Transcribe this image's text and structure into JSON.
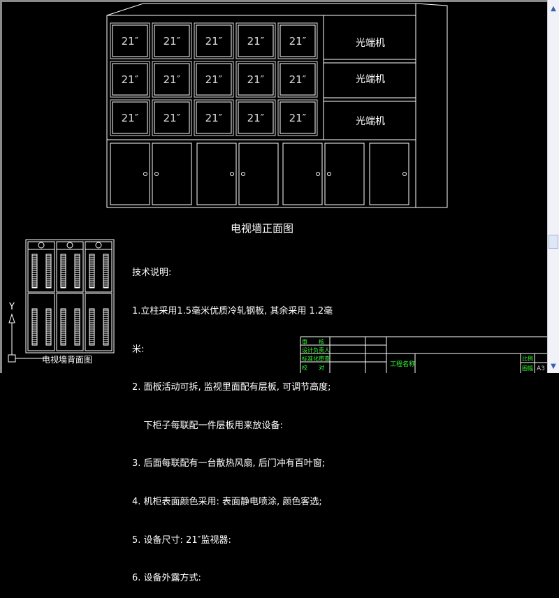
{
  "drawing": {
    "front_title": "电视墙正面图",
    "back_title": "电视墙背面图",
    "monitor_label": "21″",
    "monitor_rows": 3,
    "monitor_cols": 5,
    "optical_units": [
      "光端机",
      "光端机",
      "光端机"
    ],
    "lower_doors": 7,
    "axis_label": "Y"
  },
  "notes": {
    "heading": "技术说明:",
    "lines": [
      "1.立柱采用1.5毫米优质冷轧钢板, 其余采用 1.2毫",
      "米:",
      "2. 面板活动可拆, 监视里面配有层板, 可调节高度;",
      "    下柜子每联配一件层板用来放设备:",
      "3. 后面每联配有一台散热风扇, 后门冲有百叶窗;",
      "4. 机柜表面颜色采用: 表面静电喷涂, 颜色客选;",
      "5. 设备尺寸: 21″监视器:",
      "6. 设备外露方式:"
    ]
  },
  "title_block": {
    "rows": [
      "审　　核",
      "设计负责人",
      "标准化审查",
      "校　　对"
    ],
    "project_name_label": "工程名称",
    "scale_label": "比例",
    "sheet_label": "图幅",
    "sheet_value": "A3"
  },
  "colors": {
    "background": "#000000",
    "lines": "#ffffff",
    "title_block_text": "#33ff33"
  },
  "scrollbar": {
    "up": "chevron-up-icon",
    "down": "chevron-down-icon"
  }
}
